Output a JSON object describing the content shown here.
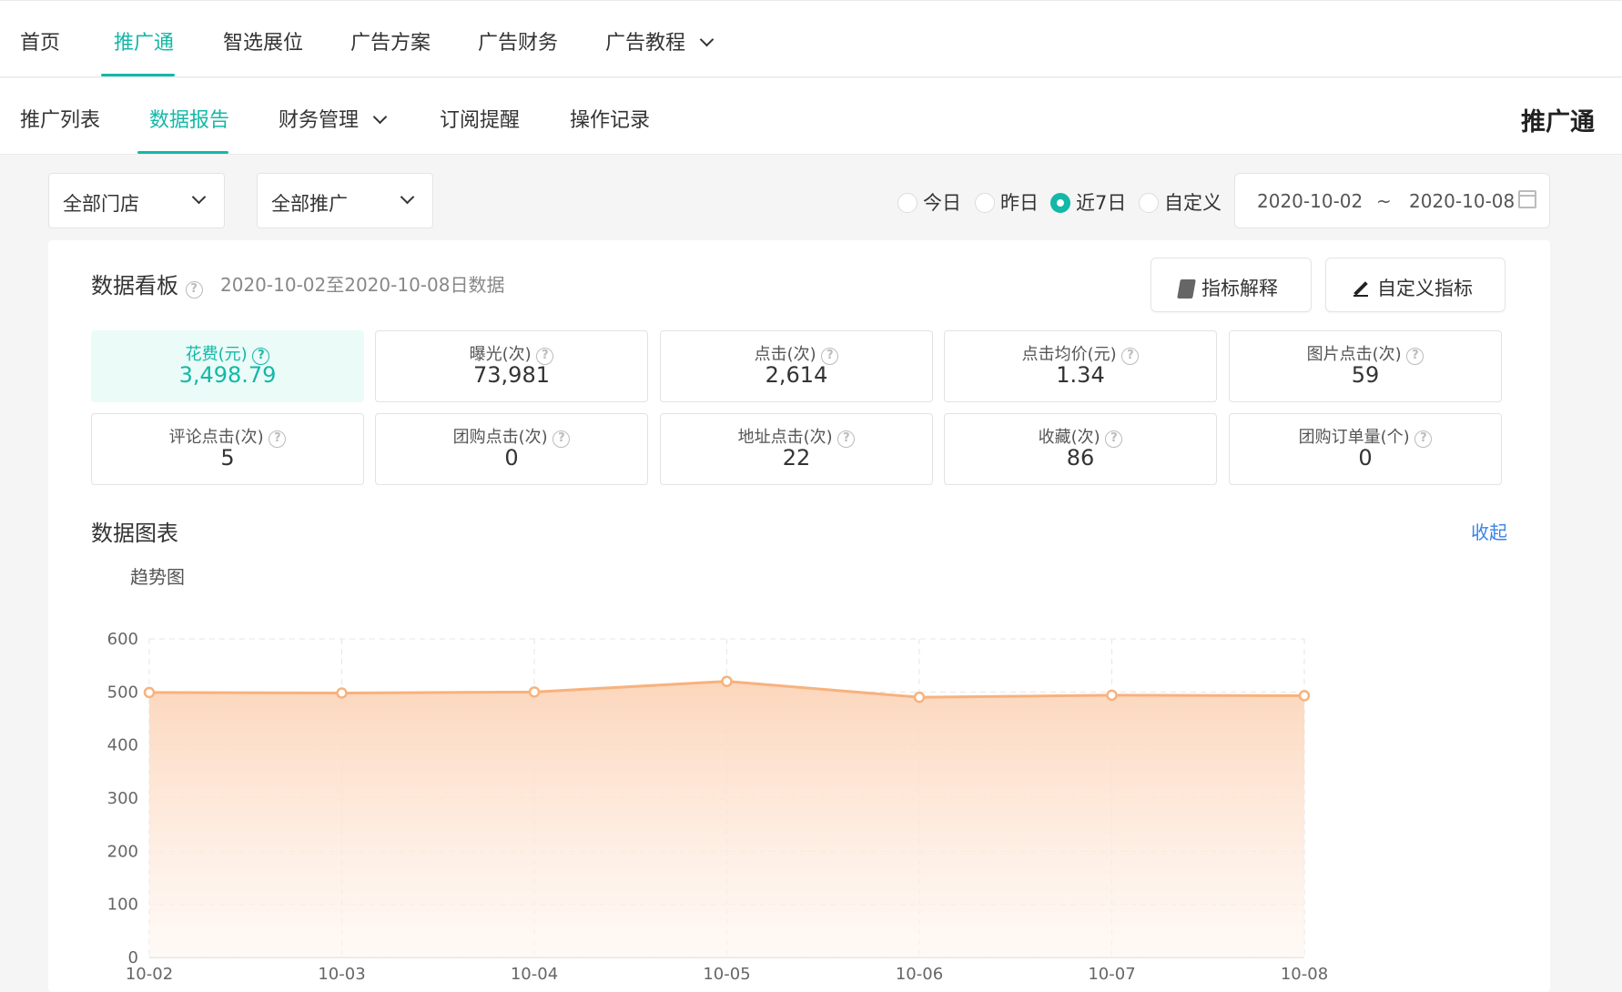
{
  "top_nav": {
    "items": [
      {
        "label": "首页",
        "active": false
      },
      {
        "label": "推广通",
        "active": true
      },
      {
        "label": "智选展位",
        "active": false
      },
      {
        "label": "广告方案",
        "active": false
      },
      {
        "label": "广告财务",
        "active": false
      },
      {
        "label": "广告教程",
        "active": false,
        "dropdown": true
      }
    ]
  },
  "sub_nav": {
    "items": [
      {
        "label": "推广列表",
        "active": false
      },
      {
        "label": "数据报告",
        "active": true
      },
      {
        "label": "财务管理",
        "active": false,
        "dropdown": true
      },
      {
        "label": "订阅提醒",
        "active": false
      },
      {
        "label": "操作记录",
        "active": false
      }
    ],
    "brand": "推广通"
  },
  "filters": {
    "store_select": "全部门店",
    "promo_select": "全部推广",
    "ranges": [
      {
        "label": "今日",
        "checked": false
      },
      {
        "label": "昨日",
        "checked": false
      },
      {
        "label": "近7日",
        "checked": true
      },
      {
        "label": "自定义",
        "checked": false
      }
    ],
    "date_start": "2020-10-02",
    "date_sep": "~",
    "date_end": "2020-10-08"
  },
  "dashboard": {
    "title": "数据看板",
    "subtitle": "2020-10-02至2020-10-08日数据",
    "explain_button": "指标解释",
    "custom_button": "自定义指标",
    "metrics": [
      {
        "label": "花费(元)",
        "value": "3,498.79",
        "active": true
      },
      {
        "label": "曝光(次)",
        "value": "73,981"
      },
      {
        "label": "点击(次)",
        "value": "2,614"
      },
      {
        "label": "点击均价(元)",
        "value": "1.34"
      },
      {
        "label": "图片点击(次)",
        "value": "59"
      },
      {
        "label": "评论点击(次)",
        "value": "5"
      },
      {
        "label": "团购点击(次)",
        "value": "0"
      },
      {
        "label": "地址点击(次)",
        "value": "22"
      },
      {
        "label": "收藏(次)",
        "value": "86"
      },
      {
        "label": "团购订单量(个)",
        "value": "0"
      }
    ]
  },
  "chart_section": {
    "title": "数据图表",
    "collapse_label": "收起",
    "trend_label": "趋势图"
  },
  "colors": {
    "accent": "#13b8a7",
    "link": "#3a83e8",
    "series": "#f7b27d"
  },
  "chart_data": {
    "type": "area",
    "x": [
      "10-02",
      "10-03",
      "10-04",
      "10-05",
      "10-06",
      "10-07",
      "10-08"
    ],
    "series": [
      {
        "values": [
          499,
          498,
          500,
          520,
          490,
          494,
          493
        ]
      }
    ],
    "yticks": [
      "0",
      "100",
      "200",
      "300",
      "400",
      "500",
      "600"
    ],
    "ylim": [
      0,
      600
    ],
    "grid": true
  }
}
